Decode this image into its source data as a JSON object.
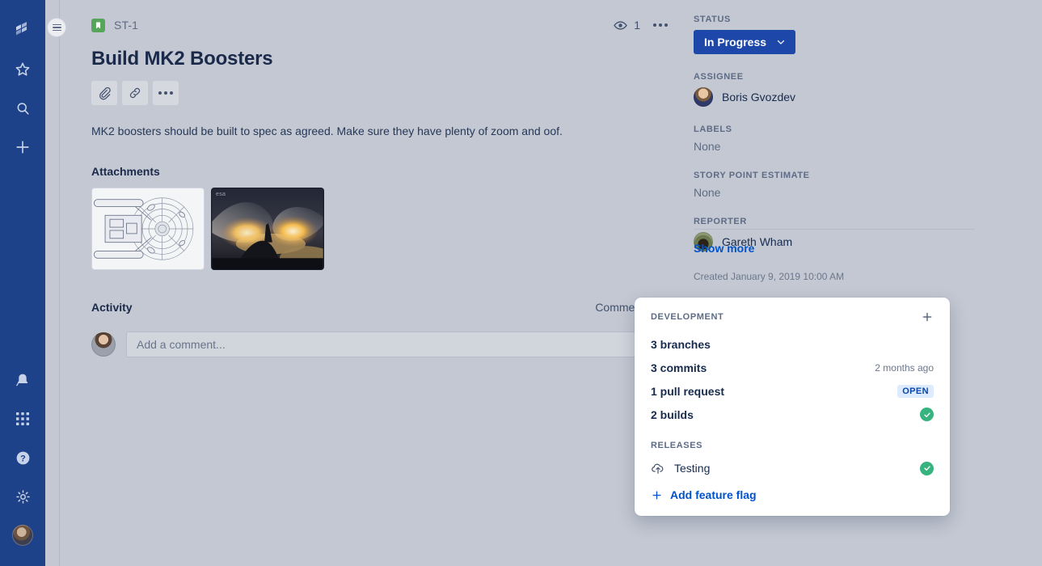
{
  "rail": {
    "top_items": [
      {
        "name": "jira-logo-icon",
        "label": "Jira"
      },
      {
        "name": "starred-icon",
        "label": "Starred"
      },
      {
        "name": "search-icon",
        "label": "Search"
      },
      {
        "name": "create-icon",
        "label": "Create"
      }
    ],
    "bottom_items": [
      {
        "name": "notifications-icon",
        "label": "Notifications"
      },
      {
        "name": "app-switcher-icon",
        "label": "App switcher"
      },
      {
        "name": "help-icon",
        "label": "Help"
      },
      {
        "name": "settings-icon",
        "label": "Settings"
      },
      {
        "name": "profile-avatar",
        "label": "Your profile"
      }
    ]
  },
  "nav_toggle": {
    "label": "Expand sidebar"
  },
  "issue": {
    "type": "Story",
    "key": "ST-1",
    "title": "Build MK2 Boosters",
    "description": "MK2 boosters should be built to spec as agreed. Make sure they have plenty of zoom and oof.",
    "watch_count": "1",
    "actions": [
      {
        "name": "attach-button",
        "label": "Attach"
      },
      {
        "name": "link-issue-button",
        "label": "Link issue"
      },
      {
        "name": "more-actions-button",
        "label": "More"
      }
    ]
  },
  "attachments": {
    "heading": "Attachments",
    "items": [
      {
        "name": "attachment-thumb-blueprint",
        "label": "Spacecraft blueprint"
      },
      {
        "name": "attachment-thumb-launch",
        "label": "Rocket launch photo",
        "watermark": "esa"
      }
    ]
  },
  "activity": {
    "heading": "Activity",
    "filter_selected": "Comments",
    "comment_placeholder": "Add a comment..."
  },
  "details": {
    "status": {
      "label": "STATUS",
      "value": "In Progress"
    },
    "assignee": {
      "label": "ASSIGNEE",
      "value": "Boris Gvozdev"
    },
    "labels": {
      "label": "LABELS",
      "value": "None"
    },
    "story_point_estimate": {
      "label": "STORY POINT ESTIMATE",
      "value": "None"
    },
    "reporter": {
      "label": "REPORTER",
      "value": "Gareth Wham"
    },
    "show_more": "Show more",
    "created": "Created January 9, 2019 10:00 AM"
  },
  "development": {
    "heading": "DEVELOPMENT",
    "add_label": "+",
    "rows": [
      {
        "name": "dev-row-branches",
        "label": "3 branches",
        "right_type": "none",
        "right_value": ""
      },
      {
        "name": "dev-row-commits",
        "label": "3 commits",
        "right_type": "time",
        "right_value": "2 months ago"
      },
      {
        "name": "dev-row-pull-request",
        "label": "1 pull request",
        "right_type": "badge",
        "right_value": "OPEN"
      },
      {
        "name": "dev-row-builds",
        "label": "2 builds",
        "right_type": "check",
        "right_value": ""
      }
    ],
    "releases_heading": "RELEASES",
    "release_name": "Testing",
    "add_feature_flag": "Add feature flag"
  },
  "colors": {
    "rail_blue": "#1d4289",
    "status_blue": "#1d47a8",
    "link_blue": "#0052cc",
    "success_green": "#36b37e",
    "story_green": "#57a55a",
    "page_bg": "#c3c8d2",
    "badge_open_bg": "#deebff",
    "badge_open_fg": "#0747a6"
  }
}
